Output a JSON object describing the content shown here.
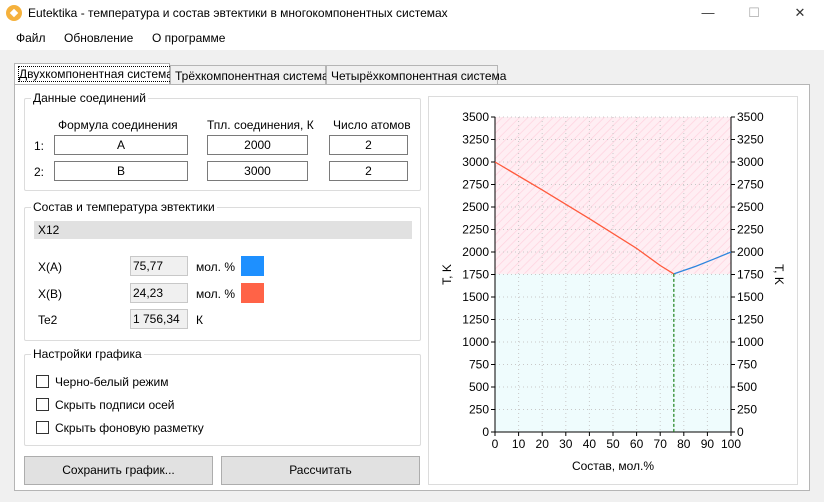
{
  "window": {
    "title": "Eutektika - температура и состав эвтектики в многокомпонентных системах",
    "minimize_glyph": "—",
    "maximize_glyph": "☐",
    "close_glyph": "✕"
  },
  "menu": [
    "Файл",
    "Обновление",
    "О программе"
  ],
  "tabs": [
    "Двухкомпонентная система",
    "Трёхкомпонентная система",
    "Четырёхкомпонентная система"
  ],
  "compounds": {
    "title": "Данные соединений",
    "headers": [
      "Формула соединения",
      "Тпл. соединения, К",
      "Число атомов"
    ],
    "rows": [
      {
        "index": "1:",
        "formula": "A",
        "tm": "2000",
        "atoms": "2"
      },
      {
        "index": "2:",
        "formula": "B",
        "tm": "3000",
        "atoms": "2"
      }
    ]
  },
  "eutectic": {
    "title": "Состав и температура эвтектики",
    "system_name": "X12",
    "rows": [
      {
        "label": "X(A)",
        "value": "75,77",
        "unit": "мол. %",
        "color": "#1e90ff"
      },
      {
        "label": "X(B)",
        "value": "24,23",
        "unit": "мол. %",
        "color": "#ff6347"
      },
      {
        "label": "Te2",
        "value": "1 756,34",
        "unit": "К"
      }
    ]
  },
  "plot_settings": {
    "title": "Настройки графика",
    "options": [
      {
        "label": "Черно-белый режим",
        "checked": false
      },
      {
        "label": "Скрыть подписи осей",
        "checked": false
      },
      {
        "label": "Скрыть фоновую разметку",
        "checked": false
      }
    ]
  },
  "buttons": {
    "save": "Сохранить график...",
    "calculate": "Рассчитать"
  },
  "chart_data": {
    "type": "line",
    "xlabel": "Состав, мол.%",
    "ylabel": "T, K",
    "y2label": "T, K",
    "xlim": [
      0,
      100
    ],
    "ylim": [
      0,
      3500
    ],
    "xticks": [
      0,
      10,
      20,
      30,
      40,
      50,
      60,
      70,
      80,
      90,
      100
    ],
    "yticks": [
      0,
      250,
      500,
      750,
      1000,
      1250,
      1500,
      1750,
      2000,
      2250,
      2500,
      2750,
      3000,
      3250,
      3500
    ],
    "eutectic": {
      "x": 75.77,
      "y": 1756.34
    },
    "series": [
      {
        "color": "#ff5a3c",
        "x": [
          0,
          20,
          40,
          60,
          70,
          75.77
        ],
        "y": [
          3000,
          2690,
          2370,
          2040,
          1850,
          1756.34
        ]
      },
      {
        "color": "#2e86de",
        "x": [
          75.77,
          85,
          93,
          100
        ],
        "y": [
          1756.34,
          1840,
          1925,
          2000
        ]
      }
    ],
    "regions": {
      "liquid_color": "#ffeef3",
      "solid_color": "#effcfd"
    },
    "grid": true
  }
}
